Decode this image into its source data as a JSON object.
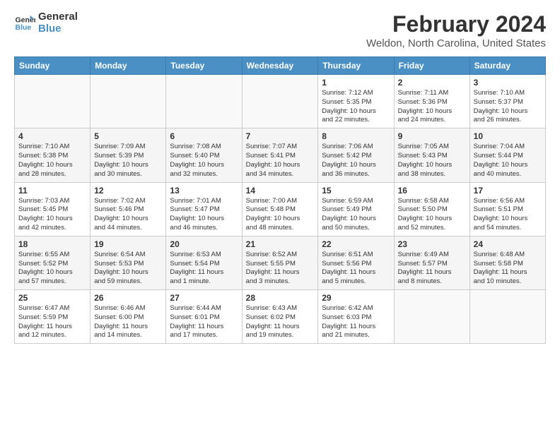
{
  "header": {
    "logo_line1": "General",
    "logo_line2": "Blue",
    "month_title": "February 2024",
    "location": "Weldon, North Carolina, United States"
  },
  "weekdays": [
    "Sunday",
    "Monday",
    "Tuesday",
    "Wednesday",
    "Thursday",
    "Friday",
    "Saturday"
  ],
  "weeks": [
    [
      {
        "day": "",
        "info": ""
      },
      {
        "day": "",
        "info": ""
      },
      {
        "day": "",
        "info": ""
      },
      {
        "day": "",
        "info": ""
      },
      {
        "day": "1",
        "info": "Sunrise: 7:12 AM\nSunset: 5:35 PM\nDaylight: 10 hours\nand 22 minutes."
      },
      {
        "day": "2",
        "info": "Sunrise: 7:11 AM\nSunset: 5:36 PM\nDaylight: 10 hours\nand 24 minutes."
      },
      {
        "day": "3",
        "info": "Sunrise: 7:10 AM\nSunset: 5:37 PM\nDaylight: 10 hours\nand 26 minutes."
      }
    ],
    [
      {
        "day": "4",
        "info": "Sunrise: 7:10 AM\nSunset: 5:38 PM\nDaylight: 10 hours\nand 28 minutes."
      },
      {
        "day": "5",
        "info": "Sunrise: 7:09 AM\nSunset: 5:39 PM\nDaylight: 10 hours\nand 30 minutes."
      },
      {
        "day": "6",
        "info": "Sunrise: 7:08 AM\nSunset: 5:40 PM\nDaylight: 10 hours\nand 32 minutes."
      },
      {
        "day": "7",
        "info": "Sunrise: 7:07 AM\nSunset: 5:41 PM\nDaylight: 10 hours\nand 34 minutes."
      },
      {
        "day": "8",
        "info": "Sunrise: 7:06 AM\nSunset: 5:42 PM\nDaylight: 10 hours\nand 36 minutes."
      },
      {
        "day": "9",
        "info": "Sunrise: 7:05 AM\nSunset: 5:43 PM\nDaylight: 10 hours\nand 38 minutes."
      },
      {
        "day": "10",
        "info": "Sunrise: 7:04 AM\nSunset: 5:44 PM\nDaylight: 10 hours\nand 40 minutes."
      }
    ],
    [
      {
        "day": "11",
        "info": "Sunrise: 7:03 AM\nSunset: 5:45 PM\nDaylight: 10 hours\nand 42 minutes."
      },
      {
        "day": "12",
        "info": "Sunrise: 7:02 AM\nSunset: 5:46 PM\nDaylight: 10 hours\nand 44 minutes."
      },
      {
        "day": "13",
        "info": "Sunrise: 7:01 AM\nSunset: 5:47 PM\nDaylight: 10 hours\nand 46 minutes."
      },
      {
        "day": "14",
        "info": "Sunrise: 7:00 AM\nSunset: 5:48 PM\nDaylight: 10 hours\nand 48 minutes."
      },
      {
        "day": "15",
        "info": "Sunrise: 6:59 AM\nSunset: 5:49 PM\nDaylight: 10 hours\nand 50 minutes."
      },
      {
        "day": "16",
        "info": "Sunrise: 6:58 AM\nSunset: 5:50 PM\nDaylight: 10 hours\nand 52 minutes."
      },
      {
        "day": "17",
        "info": "Sunrise: 6:56 AM\nSunset: 5:51 PM\nDaylight: 10 hours\nand 54 minutes."
      }
    ],
    [
      {
        "day": "18",
        "info": "Sunrise: 6:55 AM\nSunset: 5:52 PM\nDaylight: 10 hours\nand 57 minutes."
      },
      {
        "day": "19",
        "info": "Sunrise: 6:54 AM\nSunset: 5:53 PM\nDaylight: 10 hours\nand 59 minutes."
      },
      {
        "day": "20",
        "info": "Sunrise: 6:53 AM\nSunset: 5:54 PM\nDaylight: 11 hours\nand 1 minute."
      },
      {
        "day": "21",
        "info": "Sunrise: 6:52 AM\nSunset: 5:55 PM\nDaylight: 11 hours\nand 3 minutes."
      },
      {
        "day": "22",
        "info": "Sunrise: 6:51 AM\nSunset: 5:56 PM\nDaylight: 11 hours\nand 5 minutes."
      },
      {
        "day": "23",
        "info": "Sunrise: 6:49 AM\nSunset: 5:57 PM\nDaylight: 11 hours\nand 8 minutes."
      },
      {
        "day": "24",
        "info": "Sunrise: 6:48 AM\nSunset: 5:58 PM\nDaylight: 11 hours\nand 10 minutes."
      }
    ],
    [
      {
        "day": "25",
        "info": "Sunrise: 6:47 AM\nSunset: 5:59 PM\nDaylight: 11 hours\nand 12 minutes."
      },
      {
        "day": "26",
        "info": "Sunrise: 6:46 AM\nSunset: 6:00 PM\nDaylight: 11 hours\nand 14 minutes."
      },
      {
        "day": "27",
        "info": "Sunrise: 6:44 AM\nSunset: 6:01 PM\nDaylight: 11 hours\nand 17 minutes."
      },
      {
        "day": "28",
        "info": "Sunrise: 6:43 AM\nSunset: 6:02 PM\nDaylight: 11 hours\nand 19 minutes."
      },
      {
        "day": "29",
        "info": "Sunrise: 6:42 AM\nSunset: 6:03 PM\nDaylight: 11 hours\nand 21 minutes."
      },
      {
        "day": "",
        "info": ""
      },
      {
        "day": "",
        "info": ""
      }
    ]
  ]
}
